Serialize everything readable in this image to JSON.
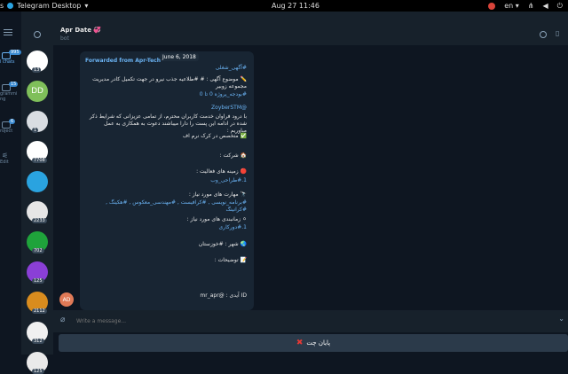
{
  "system": {
    "app_name": "Telegram Desktop",
    "clock": "Aug 27  11:46",
    "lang": "en",
    "activities": "s"
  },
  "rail": {
    "all_badge": "995",
    "all_label": "l chats",
    "folder2_badge": "15",
    "folder2_label": "grammi ng",
    "folder3_badge": "6",
    "folder3_label": "roject",
    "edit_label": "Edit"
  },
  "chatlist": {
    "avatars": [
      {
        "text": "",
        "color": "#ffffff",
        "count": "13"
      },
      {
        "text": "DD",
        "color": "#7fbf5a",
        "count": ""
      },
      {
        "text": "",
        "color": "#d9dde2",
        "count": "1"
      },
      {
        "text": "",
        "color": "#ffffff",
        "count": "7708"
      },
      {
        "text": "",
        "color": "#2aa3e0",
        "count": ""
      },
      {
        "text": "",
        "color": "#e6e6e6",
        "count": "2233"
      },
      {
        "text": "",
        "color": "#1fa33b",
        "count": "702"
      },
      {
        "text": "",
        "color": "#8a3fd6",
        "count": "125"
      },
      {
        "text": "",
        "color": "#d98c1e",
        "count": "2112"
      },
      {
        "text": "",
        "color": "#f0f0f0",
        "count": "312"
      },
      {
        "text": "",
        "color": "#eaeaea",
        "count": "125"
      }
    ]
  },
  "header": {
    "title": "Apr Date 💞",
    "subtitle": "bot"
  },
  "message": {
    "forwarded": "Forwarded from Apr-Tech",
    "date_badge": "June 6, 2018",
    "tag_top": "#آگهی_شغلی",
    "lines": [
      "✏️ موضوع آگهی : #‌ #طلاعیه جذب نیرو در جهت تکمیل کادر مدیریت مجموعه زوبیر",
      "#بودجه_پروژه 0 تا 0",
      "@ZoyberSTM",
      "با درود فراوان خدمت کاربران محترم، از  تمامی عزیزانی که شرایط ذکر شده در ادامه این پست را دارا میباشند دعوت به همکاری به عمل میاوریم :",
      "✅ متخصص در کرک نرم اف",
      "🏠 شرکت :",
      "🔴 زمینه های فعالیت :",
      "1.#طراحی_وب",
      "🔭 مهارت های مورد نیاز :",
      "#برنامه_نویسی , #کرافیست , #مهندسی_معکوس , #هکینگ , #کرانینگ",
      "⚪ زمانبندی های مورد نیاز :",
      "1.#دورکاری",
      "🌏 شهر : #خوزستان",
      "📝 توضیحات :",
      "ID آیدی : @mr_apr"
    ],
    "sender_avatar": "AD"
  },
  "input": {
    "placeholder": "Write a message..."
  },
  "bottom_button": {
    "label": "پایان چت"
  },
  "colors": {
    "accent": "#6ab2f2",
    "panel": "#17212b",
    "background": "#0e1621"
  }
}
